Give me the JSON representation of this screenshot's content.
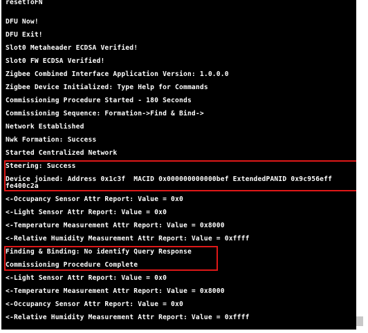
{
  "console": {
    "lines": [
      "resetToFN",
      "DFU Now!",
      "DFU Exit!",
      "Slot0 Metaheader ECDSA Verified!",
      "Slot0 FW ECDSA Verified!",
      "Zigbee Combined Interface Application Version: 1.0.0.0",
      "Zigbee Device Initialized: Type Help for Commands",
      "Commissioning Procedure Started - 180 Seconds",
      "Commissioning Sequence: Formation->Find & Bind->",
      "Network Established",
      "Nwk Formation: Success",
      "Started Centralized Network",
      "Steering: Success",
      "Device joined: Address 0x1c3f  MACID 0x000000000000bef ExtendedPANID 0x9c956eff",
      "fe400c2a",
      "<-Occupancy Sensor Attr Report: Value = 0x0",
      "<-Light Sensor Attr Report: Value = 0x0",
      "<-Temperature Measurement Attr Report: Value = 0x8000",
      "<-Relative Humidity Measurement Attr Report: Value = 0xffff",
      "Finding & Binding: No identify Query Response",
      "Commissioning Procedure Complete",
      "<-Light Sensor Attr Report: Value = 0x0",
      "<-Temperature Measurement Attr Report: Value = 0x8000",
      "<-Occupancy Sensor Attr Report: Value = 0x0",
      "<-Relative Humidity Measurement Attr Report: Value = 0xffff"
    ]
  },
  "colors": {
    "background": "#000000",
    "text": "#ffffff",
    "highlight": "#e01818"
  }
}
